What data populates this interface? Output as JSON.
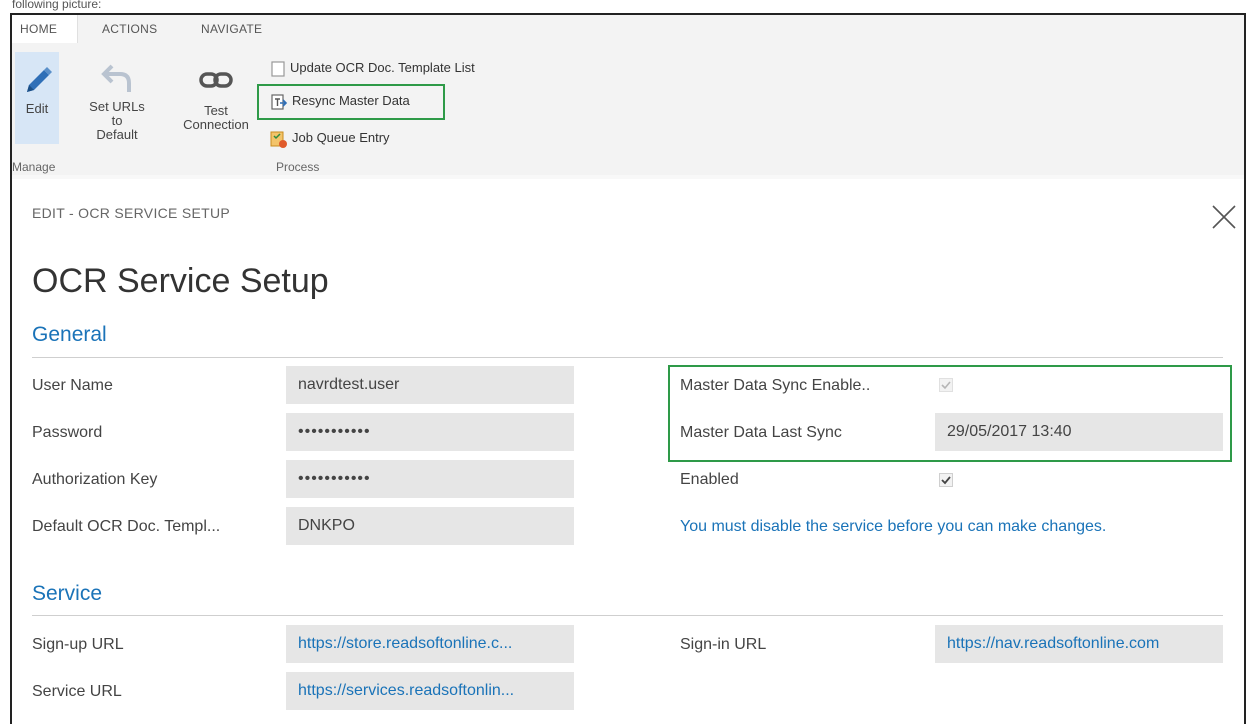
{
  "top_caption": "following picture:",
  "ribbon": {
    "tabs": [
      "HOME",
      "ACTIONS",
      "NAVIGATE"
    ],
    "edit_label": "Edit",
    "set_urls_label_line1": "Set URLs to",
    "set_urls_label_line2": "Default",
    "test_connection_line1": "Test",
    "test_connection_line2": "Connection",
    "update_template_label": "Update OCR Doc. Template List",
    "resync_label": "Resync Master Data",
    "job_queue_label": "Job Queue Entry",
    "group_manage": "Manage",
    "group_process": "Process"
  },
  "page": {
    "caption": "EDIT - OCR SERVICE SETUP",
    "title": "OCR Service Setup"
  },
  "general": {
    "heading": "General",
    "user_name_label": "User Name",
    "user_name_value": "navrdtest.user",
    "password_label": "Password",
    "password_value": "•••••••••••",
    "auth_key_label": "Authorization Key",
    "auth_key_value": "•••••••••••",
    "default_template_label": "Default OCR Doc. Templ...",
    "default_template_value": "DNKPO",
    "master_sync_enabled_label": "Master Data Sync Enable..",
    "master_sync_enabled_value": true,
    "master_last_sync_label": "Master Data Last Sync",
    "master_last_sync_value": "29/05/2017 13:40",
    "enabled_label": "Enabled",
    "enabled_value": true,
    "warning_message": "You must disable the service before you can make changes."
  },
  "service": {
    "heading": "Service",
    "signup_label": "Sign-up URL",
    "signup_value": "https://store.readsoftonline.c...",
    "signin_label": "Sign-in URL",
    "signin_value": "https://nav.readsoftonline.com",
    "service_url_label": "Service URL",
    "service_url_value": "https://services.readsoftonlin..."
  },
  "colors": {
    "accent": "#1a73b8",
    "highlight": "#2e9a48",
    "field_bg": "#e6e6e6"
  }
}
